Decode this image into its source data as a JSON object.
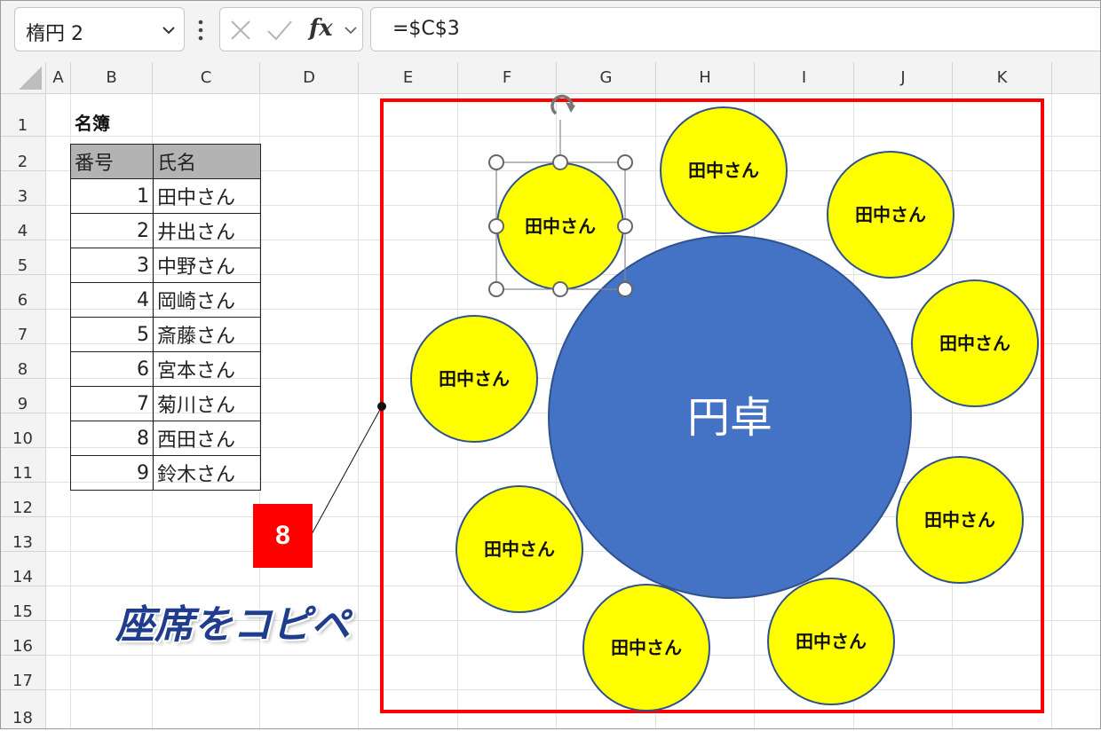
{
  "formula_bar": {
    "name_box": "楕円 2",
    "fx_label": "fx",
    "formula": "=$C$3"
  },
  "grid": {
    "columns": [
      "A",
      "B",
      "C",
      "D",
      "E",
      "F",
      "G",
      "H",
      "I",
      "J",
      "K"
    ],
    "rows": [
      "1",
      "2",
      "3",
      "4",
      "5",
      "6",
      "7",
      "8",
      "9",
      "10",
      "11",
      "12",
      "13",
      "14",
      "15",
      "16",
      "17",
      "18"
    ]
  },
  "roster": {
    "title": "名簿",
    "headers": [
      "番号",
      "氏名"
    ],
    "rows": [
      {
        "num": "1",
        "name": "田中さん"
      },
      {
        "num": "2",
        "name": "井出さん"
      },
      {
        "num": "3",
        "name": "中野さん"
      },
      {
        "num": "4",
        "name": "岡崎さん"
      },
      {
        "num": "5",
        "name": "斎藤さん"
      },
      {
        "num": "6",
        "name": "宮本さん"
      },
      {
        "num": "7",
        "name": "菊川さん"
      },
      {
        "num": "8",
        "name": "西田さん"
      },
      {
        "num": "9",
        "name": "鈴木さん"
      }
    ]
  },
  "diagram": {
    "table_label": "円卓",
    "seats": [
      "田中さん",
      "田中さん",
      "田中さん",
      "田中さん",
      "田中さん",
      "田中さん",
      "田中さん",
      "田中さん",
      "田中さん"
    ]
  },
  "callout": {
    "step_number": "8",
    "caption": "座席をコピペ"
  },
  "colors": {
    "seat_fill": "#ffff00",
    "table_fill": "#4472c4",
    "highlight_border": "#ff0000",
    "caption_color": "#1f3d8c"
  }
}
